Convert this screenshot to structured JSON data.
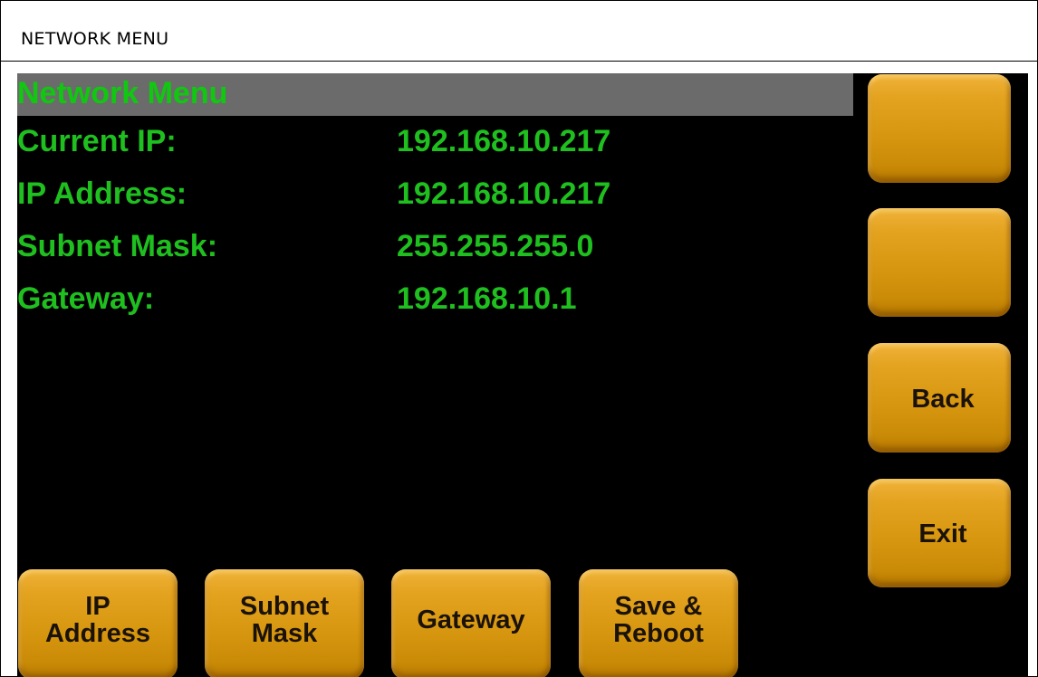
{
  "window": {
    "caption": "NETWORK MENU"
  },
  "screen": {
    "title": "Network Menu",
    "rows": [
      {
        "label": "Current IP:",
        "value": "192.168.10.217"
      },
      {
        "label": "IP Address:",
        "value": "192.168.10.217"
      },
      {
        "label": "Subnet Mask:",
        "value": "255.255.255.0"
      },
      {
        "label": "Gateway:",
        "value": "192.168.10.1"
      }
    ],
    "colors": {
      "text_green": "#1fbf1f",
      "title_bar_gray": "#6b6b6b",
      "button_gold": "#d6950e",
      "background": "#000000"
    }
  },
  "side_buttons": [
    {
      "label": ""
    },
    {
      "label": ""
    },
    {
      "label": "Back"
    },
    {
      "label": "Exit"
    }
  ],
  "bottom_buttons": [
    {
      "label": "IP\nAddress"
    },
    {
      "label": "Subnet\nMask"
    },
    {
      "label": "Gateway"
    },
    {
      "label": "Save &\nReboot"
    }
  ]
}
